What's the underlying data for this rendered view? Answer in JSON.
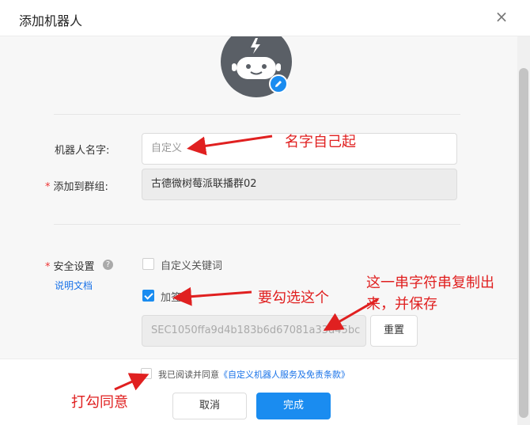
{
  "dialog": {
    "title": "添加机器人",
    "close_glyph": "×"
  },
  "form": {
    "robot_name": {
      "label": "机器人名字:",
      "placeholder": "自定义"
    },
    "group": {
      "label": "添加到群组:",
      "value": "古德微树莓派联播群02"
    },
    "security": {
      "label": "安全设置",
      "help_glyph": "?",
      "doc_link": "说明文档",
      "options": [
        {
          "label": "自定义关键词",
          "checked": false
        },
        {
          "label": "加签",
          "checked": true
        }
      ],
      "secret_value": "SEC1050ffa9d4b183b6d67081a33d45bc",
      "reset_label": "重置"
    }
  },
  "footer": {
    "agree_prefix": "我已阅读并同意",
    "agree_link": "《自定义机器人服务及免责条款》",
    "cancel_label": "取消",
    "done_label": "完成"
  },
  "annotations": {
    "name_note": "名字自己起",
    "sign_note": "要勾选这个",
    "copy_note_1": "这一串字符串复制出",
    "copy_note_2": "来，并保存",
    "agree_note": "打勾同意"
  },
  "colors": {
    "accent": "#1a8cf0",
    "annotation_red": "#e02020",
    "required": "#e33"
  },
  "icons": [
    "close-icon",
    "robot-avatar-icon",
    "pencil-icon",
    "help-icon",
    "checkmark-icon"
  ]
}
